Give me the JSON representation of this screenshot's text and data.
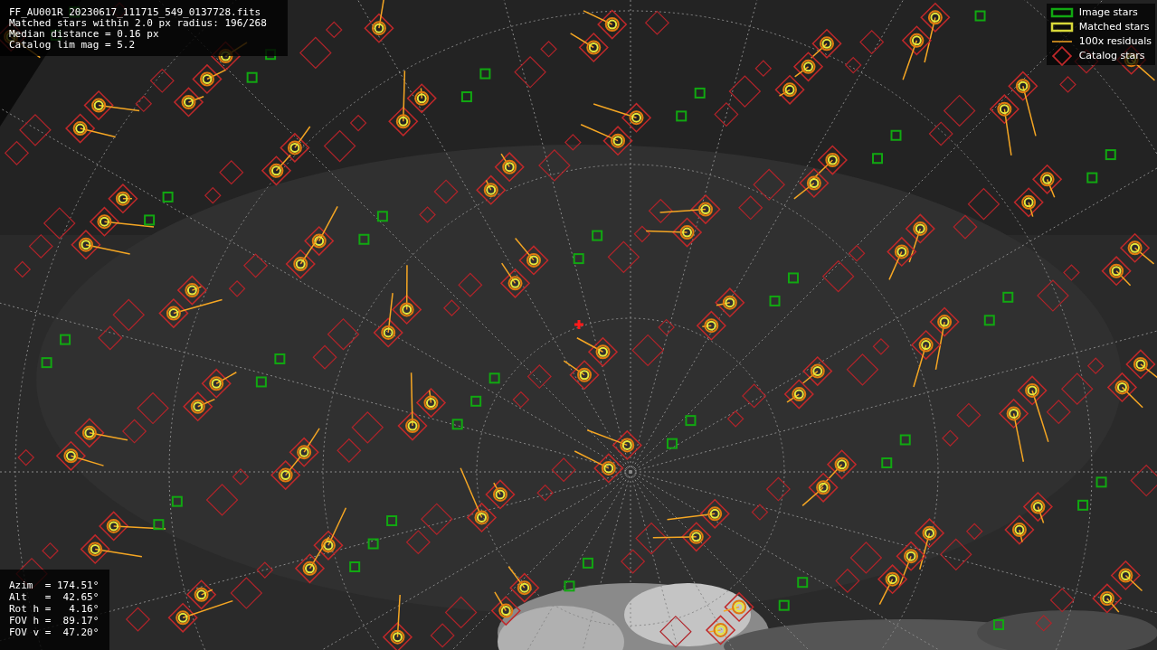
{
  "info": {
    "lines": [
      "FF_AU001R_20230617_111715_549_0137728.fits",
      "Matched stars within 2.0 px radius: 196/268",
      "Median distance = 0.16 px",
      "Catalog lim mag = 5.2"
    ]
  },
  "legend": [
    {
      "kind": "image",
      "label": "Image stars"
    },
    {
      "kind": "matched",
      "label": "Matched stars"
    },
    {
      "kind": "residual",
      "label": "100x residuals"
    },
    {
      "kind": "catalog",
      "label": "Catalog stars"
    }
  ],
  "pointing": {
    "lines": [
      "Azim  = 174.51°",
      "Alt   =  42.65°",
      "Rot h =   4.16°",
      "FOV h =  89.17°",
      "FOV v =  47.20°"
    ]
  }
}
